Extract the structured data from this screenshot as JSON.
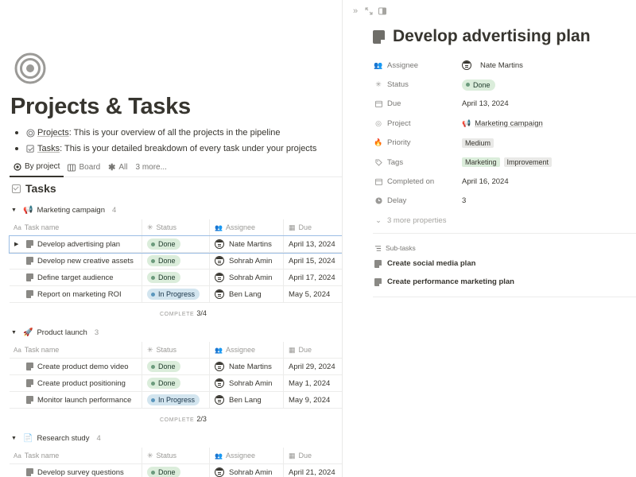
{
  "page": {
    "title": "Projects & Tasks",
    "bullets": [
      {
        "link": "Projects",
        "rest": ": This is your overview of all the projects in the pipeline"
      },
      {
        "link": "Tasks",
        "rest": ": This is your detailed breakdown of every task under your projects"
      }
    ]
  },
  "views": [
    "By project",
    "Board",
    "All",
    "3 more..."
  ],
  "database": {
    "title": "Tasks"
  },
  "columns": {
    "name": "Task name",
    "status": "Status",
    "assignee": "Assignee",
    "due": "Due"
  },
  "groups": [
    {
      "name": "Marketing campaign",
      "icon": "📢",
      "count": "4",
      "complete_label": "COMPLETE",
      "complete": "3/4",
      "rows": [
        {
          "name": "Develop advertising plan",
          "status": "Done",
          "assignee": "Nate Martins",
          "due": "April 13, 2024"
        },
        {
          "name": "Develop new creative assets",
          "status": "Done",
          "assignee": "Sohrab Amin",
          "due": "April 15, 2024"
        },
        {
          "name": "Define target audience",
          "status": "Done",
          "assignee": "Sohrab Amin",
          "due": "April 17, 2024"
        },
        {
          "name": "Report on marketing ROI",
          "status": "In Progress",
          "assignee": "Ben Lang",
          "due": "May 5, 2024"
        }
      ]
    },
    {
      "name": "Product launch",
      "icon": "🚀",
      "count": "3",
      "complete_label": "COMPLETE",
      "complete": "2/3",
      "rows": [
        {
          "name": "Create product demo video",
          "status": "Done",
          "assignee": "Nate Martins",
          "due": "April 29, 2024"
        },
        {
          "name": "Create product positioning",
          "status": "Done",
          "assignee": "Sohrab Amin",
          "due": "May 1, 2024"
        },
        {
          "name": "Monitor launch performance",
          "status": "In Progress",
          "assignee": "Ben Lang",
          "due": "May 9, 2024"
        }
      ]
    },
    {
      "name": "Research study",
      "icon": "📄",
      "count": "4",
      "rows": [
        {
          "name": "Develop survey questions",
          "status": "Done",
          "assignee": "Sohrab Amin",
          "due": "April 21, 2024"
        }
      ]
    }
  ],
  "panel": {
    "title": "Develop advertising plan",
    "props": {
      "assignee_label": "Assignee",
      "assignee": "Nate Martins",
      "status_label": "Status",
      "status": "Done",
      "due_label": "Due",
      "due": "April 13, 2024",
      "project_label": "Project",
      "project": "Marketing campaign",
      "project_icon": "📢",
      "priority_label": "Priority",
      "priority": "Medium",
      "tags_label": "Tags",
      "tags": [
        "Marketing",
        "Improvement"
      ],
      "completed_label": "Completed on",
      "completed": "April 16, 2024",
      "delay_label": "Delay",
      "delay": "3",
      "more": "3 more properties"
    },
    "subtasks_label": "Sub-tasks",
    "subtasks": [
      "Create social media plan",
      "Create performance marketing plan"
    ]
  },
  "colors": {
    "done_bg": "#dbeddb",
    "progress_bg": "#d3e5ef",
    "selection": "#9bbde4"
  }
}
